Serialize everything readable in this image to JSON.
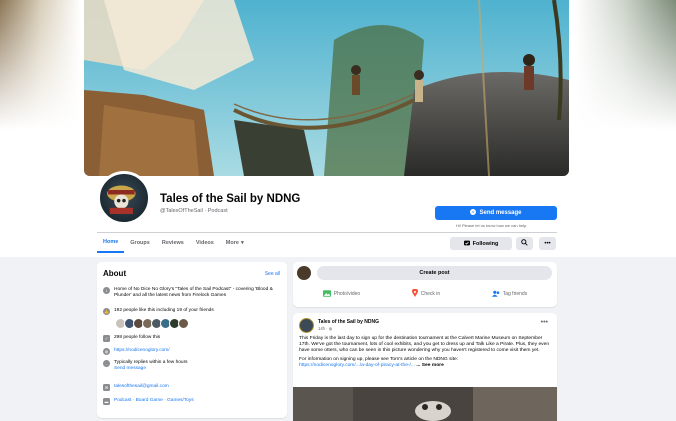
{
  "page": {
    "name": "Tales of the Sail by NDNG",
    "handle": "@TalesOfTheSail · Podcast"
  },
  "actions": {
    "send_message": "Send message",
    "send_hint": "Hi! Please let us know how we can help.",
    "following": "Following"
  },
  "tabs": [
    {
      "label": "Home",
      "active": true
    },
    {
      "label": "Groups"
    },
    {
      "label": "Reviews"
    },
    {
      "label": "Videos"
    },
    {
      "label": "More"
    }
  ],
  "about": {
    "title": "About",
    "see_all": "See all",
    "description": "Home of No Dice No Glory's \"Tales of the Sail Podcast\" - covering 'Blood & Plunder' and all the latest news from Firelock Games",
    "likes": "192 people like this including 19 of your friends",
    "follows": "298 people follow this",
    "website": "https://nodicenoglory.com/",
    "reply_time": "Typically replies within a few hours",
    "send_message": "Send message",
    "email": "talesofthesail@gmail.com",
    "category": "Podcast · Board Game · Games/Toys"
  },
  "create_post": {
    "button": "Create post",
    "photo": "Photo/video",
    "checkin": "Check in",
    "tag": "Tag friends"
  },
  "post": {
    "author": "Tales of the Sail by NDNG",
    "time": "14h · ",
    "body": "This Friday is the last day to sign up for the destination tournament at the Calvert Marine Museum on September 17th. We've got the tournament, lots of cool exhibits, and you get to dress up and Talk Like a Pirate. Plus, they even have some otters, who can be seen in this picture wondering why you haven't registered to come visit them yet.",
    "info_prefix": "For information on signing up, please see Tom's article on the NDNG site:",
    "link": "https://nodicenoglory.com/.../a-day-of-piracy-at-the-/...",
    "see_more": "... See more"
  },
  "colors": {
    "accent": "#1877f2",
    "background": "#f0f2f5"
  }
}
